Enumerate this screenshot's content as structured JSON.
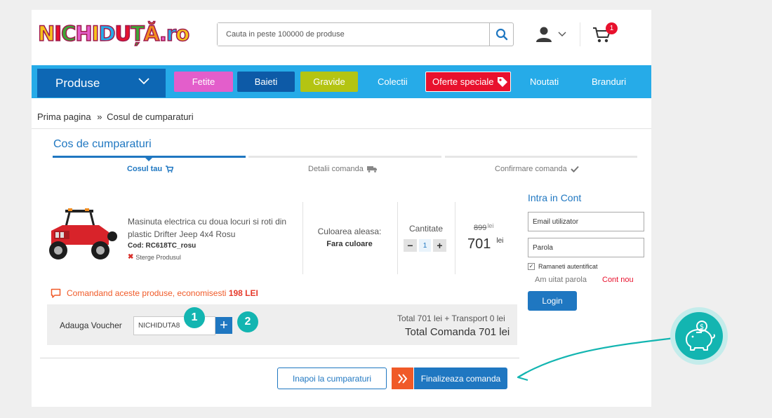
{
  "header": {
    "logo_letters": [
      "N",
      "I",
      "C",
      "H",
      "I",
      "D",
      "U",
      "Ț",
      "Ă",
      ".",
      "r",
      "o"
    ],
    "search_placeholder": "Cauta in peste 100000 de produse",
    "cart_count": "1"
  },
  "nav": {
    "produse": "Produse",
    "items": [
      {
        "label": "Fetite",
        "color": "#e35ecb"
      },
      {
        "label": "Baieti",
        "color": "#0d5aa7"
      },
      {
        "label": "Gravide",
        "color": "#b4c412"
      },
      {
        "label": "Colectii"
      },
      {
        "label": "Oferte speciale",
        "color": "#e8112d"
      },
      {
        "label": "Noutati"
      },
      {
        "label": "Branduri"
      }
    ]
  },
  "breadcrumb": {
    "home": "Prima pagina",
    "sep": "»",
    "current": "Cosul de cumparaturi"
  },
  "cart": {
    "title": "Cos de cumparaturi",
    "steps": [
      "Cosul tau",
      "Detalii comanda",
      "Confirmare comanda"
    ]
  },
  "product": {
    "name": "Masinuta electrica cu doua locuri si roti din plastic Drifter Jeep 4x4 Rosu",
    "code": "Cod: RC618TC_rosu",
    "delete": "Sterge Produsul",
    "color_label": "Culoarea aleasa:",
    "color_value": "Fara culoare",
    "qty_label": "Cantitate",
    "qty_minus": "−",
    "qty_value": "1",
    "qty_plus": "+",
    "old_price": "899",
    "old_currency": "lei",
    "new_price": "701",
    "new_currency": "lei"
  },
  "savings": {
    "text": "Comandand aceste produse, economisesti",
    "amount": "198 LEI"
  },
  "voucher": {
    "label": "Adauga Voucher",
    "value": "NICHIDUTA8",
    "add_symbol": "+",
    "badge1": "1",
    "badge2": "2"
  },
  "totals": {
    "line1": "Total 701 lei + Transport 0 lei",
    "line2": "Total Comanda 701 lei"
  },
  "buttons": {
    "back": "Inapoi la cumparaturi",
    "finish": "Finalizeaza comanda"
  },
  "login": {
    "title": "Intra in Cont",
    "email_placeholder": "Email utilizator",
    "password_placeholder": "Parola",
    "remember": "Ramaneti autentificat",
    "forgot": "Am uitat parola",
    "new_account": "Cont nou",
    "submit": "Login"
  }
}
